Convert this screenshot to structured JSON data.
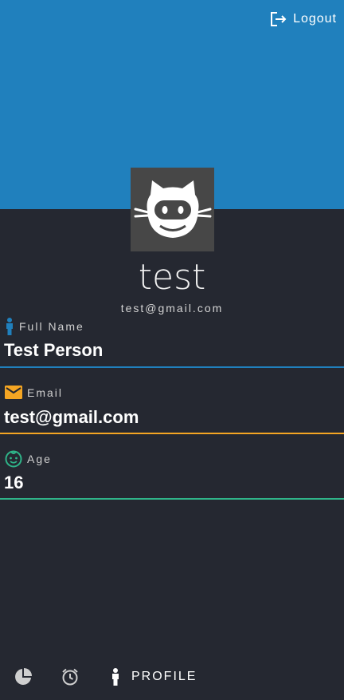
{
  "header": {
    "logout_label": "Logout",
    "logout_icon": "logout-icon",
    "color": "#2080bd"
  },
  "profile": {
    "avatar_icon": "octocat-avatar-icon",
    "username": "test",
    "email": "test@gmail.com"
  },
  "fields": [
    {
      "icon": "person-icon",
      "label": "Full Name",
      "value": "Test Person",
      "accent": "#2080bd"
    },
    {
      "icon": "mail-icon",
      "label": "Email",
      "value": "test@gmail.com",
      "accent": "#f5a623"
    },
    {
      "icon": "baby-face-icon",
      "label": "Age",
      "value": "16",
      "accent": "#2fb489"
    }
  ],
  "bottom_nav": {
    "items": [
      {
        "icon": "pie-chart-icon"
      },
      {
        "icon": "alarm-clock-icon"
      },
      {
        "icon": "person-icon",
        "label": "PROFILE"
      }
    ]
  },
  "colors": {
    "background": "#252831",
    "avatar_bg": "#474747"
  }
}
